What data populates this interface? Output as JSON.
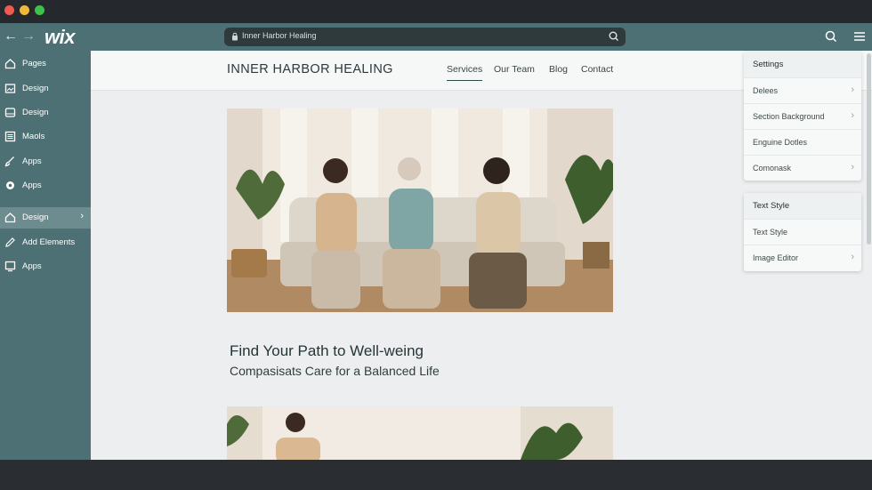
{
  "browser": {
    "url": "Inner Harbor Healing",
    "logo": "wix"
  },
  "sidebar": {
    "items": [
      {
        "label": "Pages",
        "icon": "house-icon"
      },
      {
        "label": "Design",
        "icon": "image-icon"
      },
      {
        "label": "Design",
        "icon": "layout-icon"
      },
      {
        "label": "Maols",
        "icon": "list-icon"
      },
      {
        "label": "Apps",
        "icon": "brush-icon"
      },
      {
        "label": "Apps",
        "icon": "gear-icon"
      },
      {
        "label": "Design",
        "icon": "house-icon",
        "active": true
      },
      {
        "label": "Add Elements",
        "icon": "pencil-icon"
      },
      {
        "label": "Apps",
        "icon": "apps-icon"
      }
    ]
  },
  "site": {
    "brand": "INNER HARBOR HEALING",
    "nav": [
      "Services",
      "Our Team",
      "Blog",
      "Contact"
    ],
    "headline": "Find Your Path to Well-weing",
    "subhead": "Compasisats Care for a Balanced Life"
  },
  "settings_panel": {
    "title": "Settings",
    "items": [
      "Delees",
      "Section Background",
      "Enguine Dotles",
      "Comonask"
    ]
  },
  "text_panel": {
    "title": "Text Style",
    "items": [
      "Text Style",
      "Image Editor"
    ]
  },
  "colors": {
    "accent": "#4d7074",
    "sidebar_active": "#6c8c8f"
  }
}
